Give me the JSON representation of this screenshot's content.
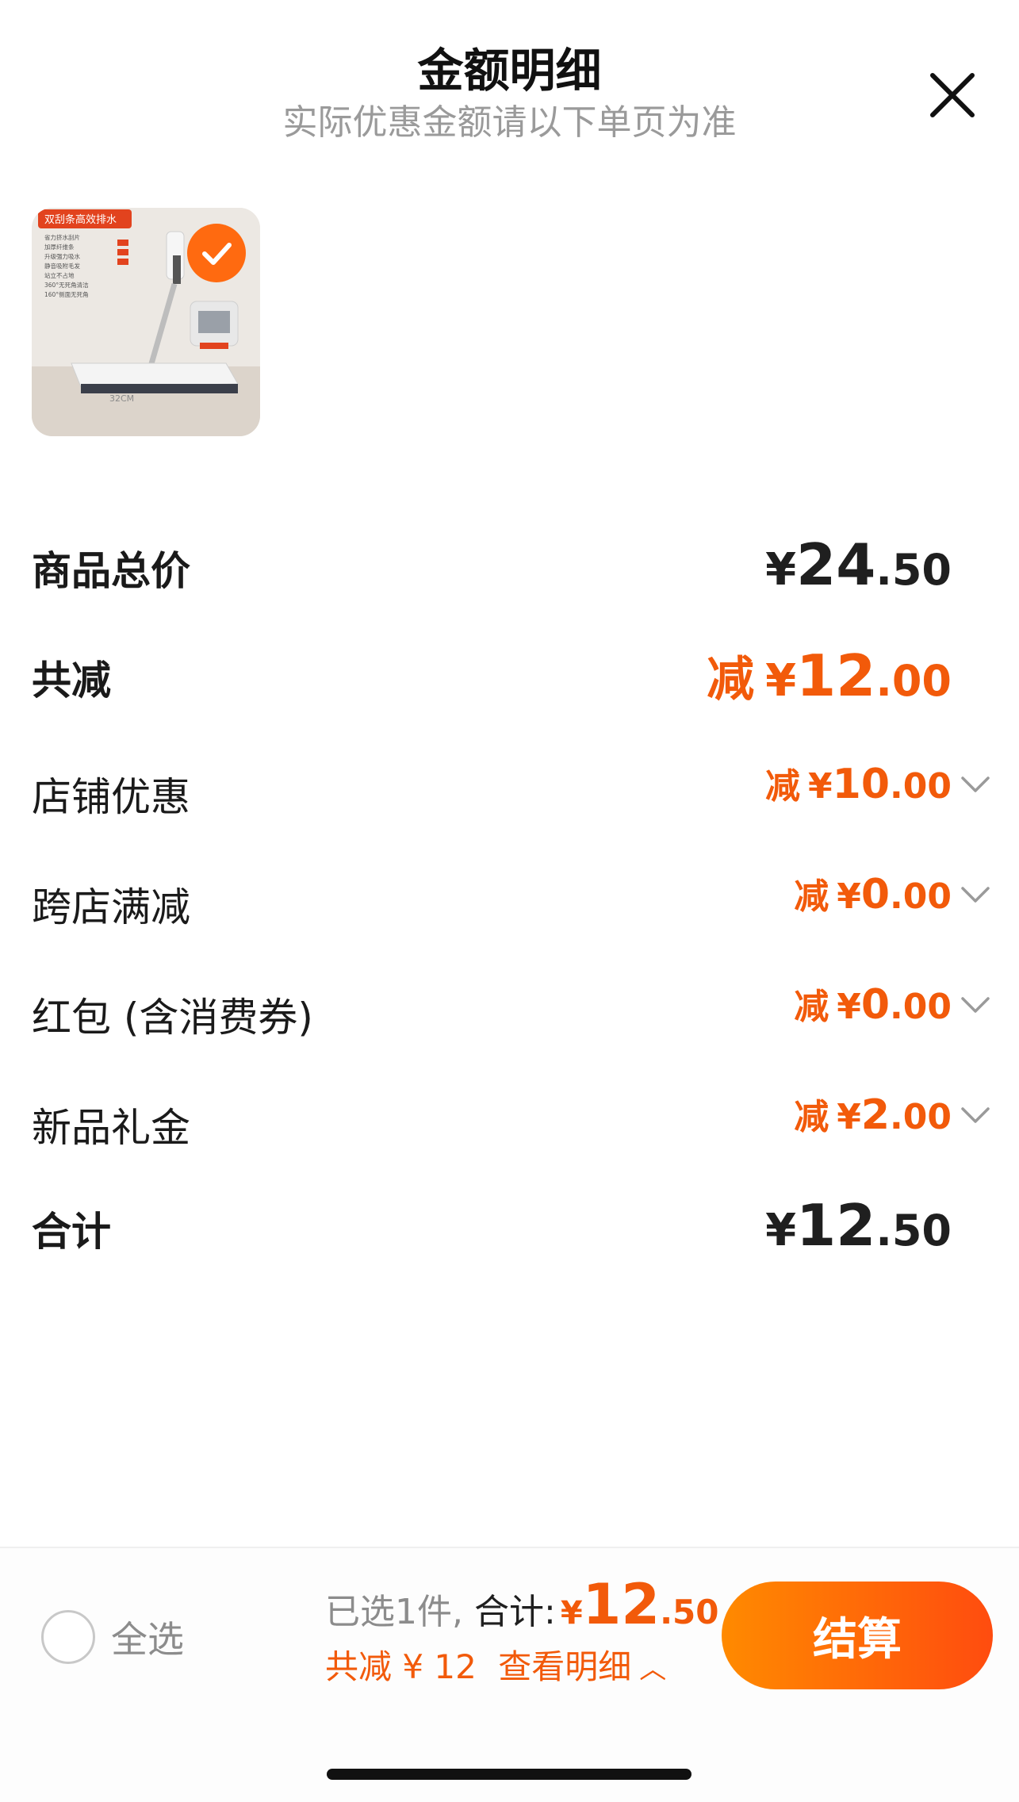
{
  "header": {
    "title": "金额明细",
    "subtitle": "实际优惠金额请以下单页为准",
    "close_icon": "close-icon"
  },
  "product": {
    "selected": true,
    "image_texts": [
      "双刮条高效排水",
      "省力挤水刮片",
      "加厚纤维条",
      "升级强力吸水",
      "静音吸附毛发",
      "站立不占地",
      "360°无死角清洁",
      "160°侧面无死角",
      "32CM"
    ]
  },
  "breakdown": {
    "total_price": {
      "label": "商品总价",
      "yen": "¥",
      "int": "24",
      "dec": ".50"
    },
    "total_discount": {
      "label": "共减",
      "prefix": "减",
      "yen": "¥",
      "int": "12",
      "dec": ".00"
    },
    "items": [
      {
        "label": "店铺优惠",
        "prefix": "减",
        "yen": "¥",
        "int": "10",
        "dec": ".00"
      },
      {
        "label": "跨店满减",
        "prefix": "减",
        "yen": "¥",
        "int": "0",
        "dec": ".00"
      },
      {
        "label": "红包 (含消费券)",
        "prefix": "减",
        "yen": "¥",
        "int": "0",
        "dec": ".00"
      },
      {
        "label": "新品礼金",
        "prefix": "减",
        "yen": "¥",
        "int": "2",
        "dec": ".00"
      }
    ],
    "grand_total": {
      "label": "合计",
      "yen": "¥",
      "int": "12",
      "dec": ".50"
    }
  },
  "bottom_bar": {
    "select_all_label": "全选",
    "selected_count_text": "已选1件,",
    "total_label": "合计:",
    "yen": "¥",
    "total_int": "12",
    "total_dec": ".50",
    "discount_text": "共减 ¥ 12",
    "detail_link": "查看明细",
    "checkout_label": "结算"
  },
  "colors": {
    "accent": "#f25a0a",
    "checkout_gradient_start": "#ff8a00",
    "checkout_gradient_end": "#ff4c0f",
    "text_dark": "#1f1f1f",
    "text_muted": "#9a9a9a"
  }
}
